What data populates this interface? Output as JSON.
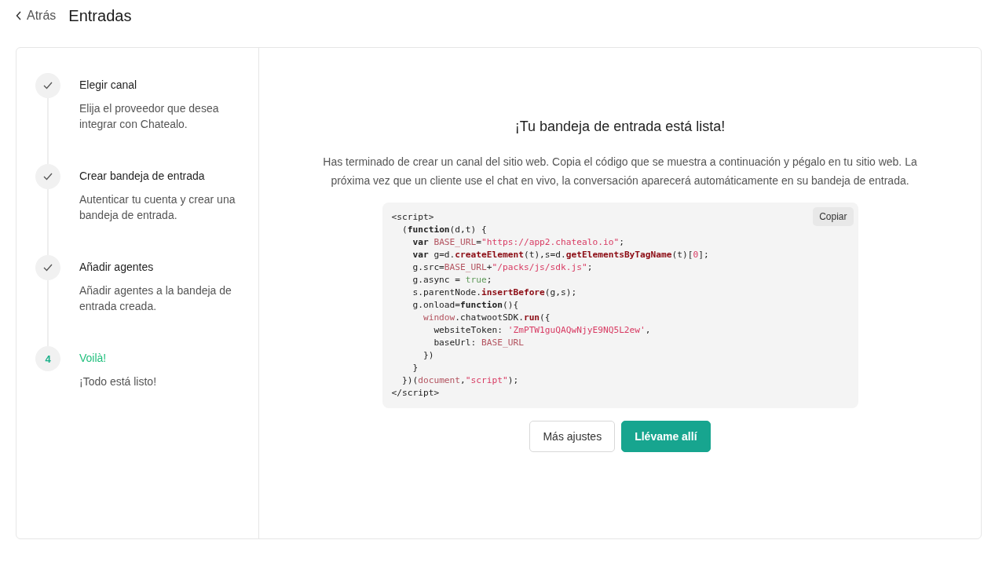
{
  "header": {
    "back": "Atrás",
    "title": "Entradas"
  },
  "steps": [
    {
      "completed": true,
      "title": "Elegir canal",
      "description": "Elija el proveedor que desea integrar con Chatealo."
    },
    {
      "completed": true,
      "title": "Crear bandeja de entrada",
      "description": "Autenticar tu cuenta y crear una bandeja de entrada."
    },
    {
      "completed": true,
      "title": "Añadir agentes",
      "description": "Añadir agentes a la bandeja de entrada creada."
    },
    {
      "completed": false,
      "number": "4",
      "title": "Voilà!",
      "description": "¡Todo está listo!"
    }
  ],
  "main": {
    "title": "¡Tu bandeja de entrada está lista!",
    "message": "Has terminado de crear un canal del sitio web. Copia el código que se muestra a continuación y pégalo en tu sitio web. La próxima vez que un cliente use el chat en vivo, la conversación aparecerá automáticamente en su bandeja de entrada.",
    "copy_button": "Copiar",
    "code_lines": [
      [
        {
          "t": "<script>",
          "kind": "plain"
        }
      ],
      [
        {
          "t": "  (",
          "kind": "plain"
        },
        {
          "t": "function",
          "kind": "keyword"
        },
        {
          "t": "(d,t) {",
          "kind": "plain"
        }
      ],
      [
        {
          "t": "    var",
          "kind": "keyword"
        },
        {
          "t": " BASE_URL",
          "kind": "variable"
        },
        {
          "t": "=",
          "kind": "plain"
        },
        {
          "t": "\"https://app2.chatealo.io\"",
          "kind": "string"
        },
        {
          "t": ";",
          "kind": "plain"
        }
      ],
      [
        {
          "t": "    var",
          "kind": "keyword"
        },
        {
          "t": " g=d.",
          "kind": "plain"
        },
        {
          "t": "createElement",
          "kind": "method"
        },
        {
          "t": "(t),s=d.",
          "kind": "plain"
        },
        {
          "t": "getElementsByTagName",
          "kind": "method"
        },
        {
          "t": "(t)[",
          "kind": "plain"
        },
        {
          "t": "0",
          "kind": "string"
        },
        {
          "t": "];",
          "kind": "plain"
        }
      ],
      [
        {
          "t": "    g.src=",
          "kind": "plain"
        },
        {
          "t": "BASE_URL",
          "kind": "variable"
        },
        {
          "t": "+",
          "kind": "plain"
        },
        {
          "t": "\"/packs/js/sdk.js\"",
          "kind": "string"
        },
        {
          "t": ";",
          "kind": "plain"
        }
      ],
      [
        {
          "t": "    g.async = ",
          "kind": "plain"
        },
        {
          "t": "true",
          "kind": "literal"
        },
        {
          "t": ";",
          "kind": "plain"
        }
      ],
      [
        {
          "t": "    s.parentNode.",
          "kind": "plain"
        },
        {
          "t": "insertBefore",
          "kind": "method"
        },
        {
          "t": "(g,s);",
          "kind": "plain"
        }
      ],
      [
        {
          "t": "    g.onload=",
          "kind": "plain"
        },
        {
          "t": "function",
          "kind": "keyword"
        },
        {
          "t": "(){",
          "kind": "plain"
        }
      ],
      [
        {
          "t": "      window",
          "kind": "variable"
        },
        {
          "t": ".chatwootSDK.",
          "kind": "plain"
        },
        {
          "t": "run",
          "kind": "method"
        },
        {
          "t": "({",
          "kind": "plain"
        }
      ],
      [
        {
          "t": "        websiteToken: ",
          "kind": "plain"
        },
        {
          "t": "'ZmPTW1guQAQwNjyE9NQ5L2ew'",
          "kind": "string"
        },
        {
          "t": ",",
          "kind": "plain"
        }
      ],
      [
        {
          "t": "        baseUrl: ",
          "kind": "plain"
        },
        {
          "t": "BASE_URL",
          "kind": "variable"
        }
      ],
      [
        {
          "t": "      })",
          "kind": "plain"
        }
      ],
      [
        {
          "t": "    }",
          "kind": "plain"
        }
      ],
      [
        {
          "t": "  })(",
          "kind": "plain"
        },
        {
          "t": "document",
          "kind": "variable"
        },
        {
          "t": ",",
          "kind": "plain"
        },
        {
          "t": "\"script\"",
          "kind": "string"
        },
        {
          "t": ");",
          "kind": "plain"
        }
      ],
      [
        {
          "t": "</script>",
          "kind": "plain"
        }
      ]
    ],
    "buttons": [
      {
        "label": "Más ajustes",
        "kind": "secondary"
      },
      {
        "label": "Llévame allí",
        "kind": "primary"
      }
    ]
  }
}
